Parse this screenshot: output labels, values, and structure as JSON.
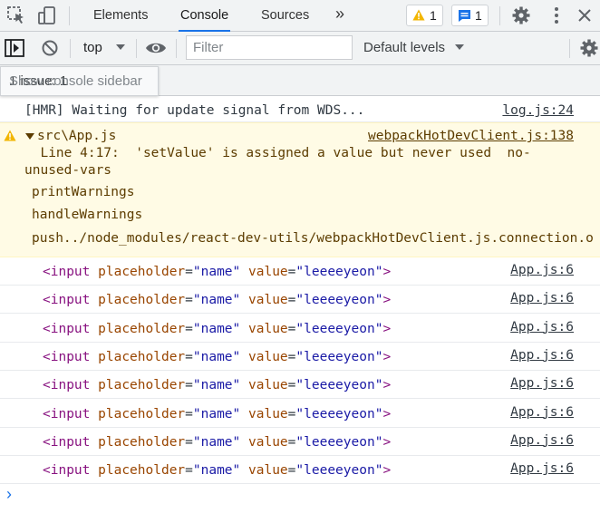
{
  "tabbar": {
    "tabs": [
      {
        "label": "Elements"
      },
      {
        "label": "Console"
      },
      {
        "label": "Sources"
      }
    ],
    "more_label": "»",
    "warnings_count": "1",
    "messages_count": "1"
  },
  "toolbar": {
    "context": "top",
    "filter_placeholder": "Filter",
    "levels_label": "Default levels"
  },
  "sidebar_tooltip": {
    "text": "Show console sidebar",
    "overlap_text": "1 issue: 1"
  },
  "console": {
    "hmr": {
      "text": "[HMR] Waiting for update signal from WDS...",
      "source": "log.js:24"
    },
    "warning": {
      "header": "src\\App.js",
      "source": "webpackHotDevClient.js:138",
      "message_line1": "  Line 4:17:  'setValue' is assigned a value but never used  no-",
      "message_line2": "unused-vars",
      "stack": [
        "printWarnings",
        "handleWarnings",
        "push../node_modules/react-dev-utils/webpackHotDevClient.js.connection.o"
      ]
    },
    "input_logs": [
      {
        "tag_open": "<input",
        "attr1": "placeholder",
        "val1": "\"name\"",
        "attr2": "value",
        "val2": "\"leeeeyeon\"",
        "tag_close": ">",
        "source": "App.js:6"
      },
      {
        "tag_open": "<input",
        "attr1": "placeholder",
        "val1": "\"name\"",
        "attr2": "value",
        "val2": "\"leeeeyeon\"",
        "tag_close": ">",
        "source": "App.js:6"
      },
      {
        "tag_open": "<input",
        "attr1": "placeholder",
        "val1": "\"name\"",
        "attr2": "value",
        "val2": "\"leeeeyeon\"",
        "tag_close": ">",
        "source": "App.js:6"
      },
      {
        "tag_open": "<input",
        "attr1": "placeholder",
        "val1": "\"name\"",
        "attr2": "value",
        "val2": "\"leeeeyeon\"",
        "tag_close": ">",
        "source": "App.js:6"
      },
      {
        "tag_open": "<input",
        "attr1": "placeholder",
        "val1": "\"name\"",
        "attr2": "value",
        "val2": "\"leeeeyeon\"",
        "tag_close": ">",
        "source": "App.js:6"
      },
      {
        "tag_open": "<input",
        "attr1": "placeholder",
        "val1": "\"name\"",
        "attr2": "value",
        "val2": "\"leeeeyeon\"",
        "tag_close": ">",
        "source": "App.js:6"
      },
      {
        "tag_open": "<input",
        "attr1": "placeholder",
        "val1": "\"name\"",
        "attr2": "value",
        "val2": "\"leeeeyeon\"",
        "tag_close": ">",
        "source": "App.js:6"
      },
      {
        "tag_open": "<input",
        "attr1": "placeholder",
        "val1": "\"name\"",
        "attr2": "value",
        "val2": "\"leeeeyeon\"",
        "tag_close": ">",
        "source": "App.js:6"
      }
    ],
    "prompt": "›"
  },
  "colors": {
    "accent": "#1a73e8",
    "warning_bg": "#fffbe5",
    "warning_text": "#5c3c00",
    "tag": "#881280",
    "attr": "#994500",
    "value": "#1a1aa6"
  }
}
